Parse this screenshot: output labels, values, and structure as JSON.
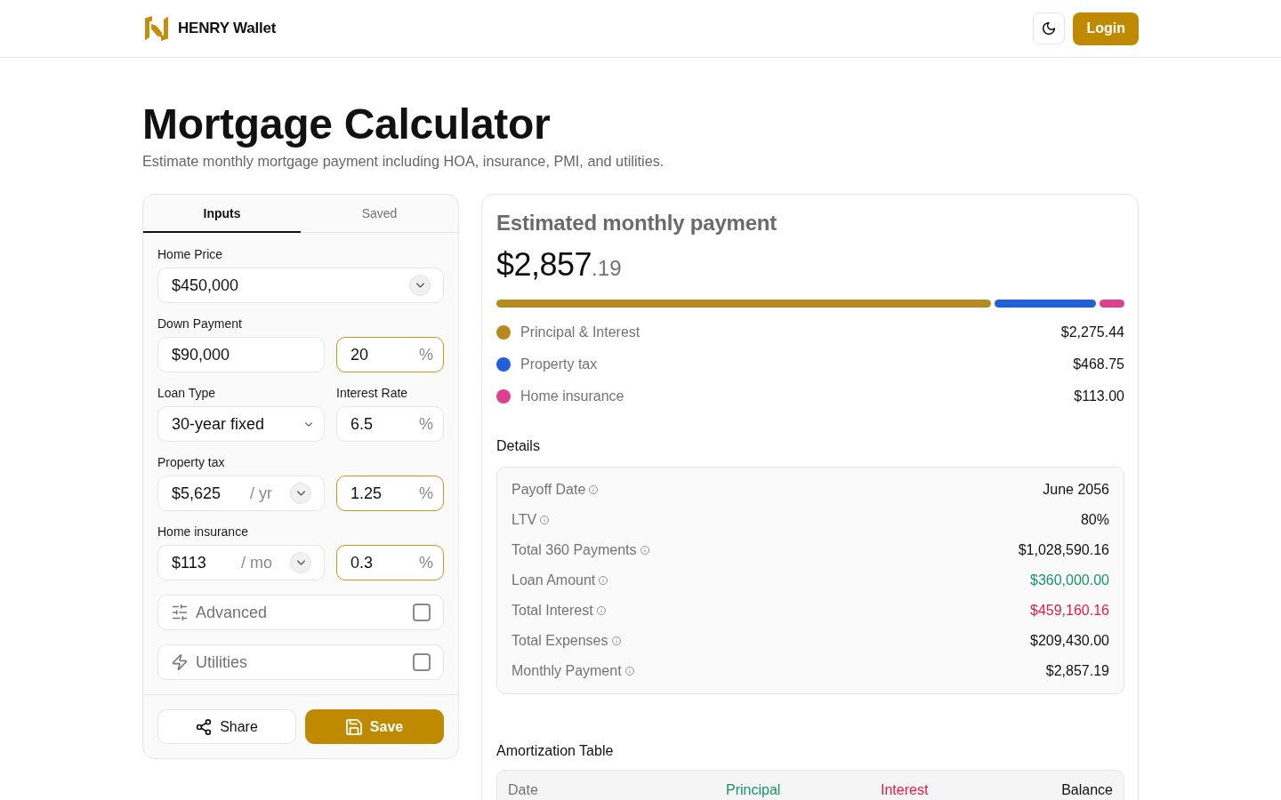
{
  "header": {
    "brand": "HENRY Wallet",
    "login_button": "Login"
  },
  "intro": {
    "title": "Mortgage Calculator",
    "subtitle": "Estimate monthly mortgage payment including HOA, insurance, PMI, and utilities."
  },
  "form": {
    "tabs": [
      {
        "label": "Inputs",
        "selected": true
      },
      {
        "label": "Saved",
        "selected": false
      }
    ],
    "rows": [
      {
        "label": "Home Price",
        "cells": [
          {
            "kind": "currency",
            "value": "$450,000",
            "dropdown": true
          }
        ]
      },
      {
        "label": "Down Payment",
        "cells": [
          {
            "kind": "currency",
            "value": "$90,000",
            "dropdown": false
          },
          {
            "kind": "percent",
            "value": "20",
            "suffix": "%",
            "accented": true
          }
        ]
      },
      {
        "cells": [
          {
            "label": "Loan Type",
            "kind": "select",
            "value": "30-year fixed"
          },
          {
            "label": "Interest Rate",
            "kind": "percent",
            "value": "6.5",
            "suffix": "%",
            "accented": false
          }
        ]
      },
      {
        "label": "Property tax",
        "cells": [
          {
            "kind": "currency",
            "value": "$5,625",
            "unit": "/ yr",
            "dropdown": true
          },
          {
            "kind": "percent",
            "value": "1.25",
            "suffix": "%",
            "accented": true
          }
        ]
      },
      {
        "label": "Home insurance",
        "cells": [
          {
            "kind": "currency",
            "value": "$113",
            "unit": "/ mo",
            "dropdown": true
          },
          {
            "kind": "percent",
            "value": "0.3",
            "suffix": "%",
            "accented": true
          }
        ]
      }
    ],
    "options": [
      {
        "label": "Advanced",
        "checked": false
      },
      {
        "label": "Utilities",
        "checked": false
      }
    ],
    "actions": [
      {
        "label": "Share",
        "kind": "secondary"
      },
      {
        "label": "Save",
        "kind": "primary"
      }
    ]
  },
  "summary": {
    "title": "Estimated monthly payment",
    "amount": "$2,857",
    "cents": ".19",
    "breakdown": [
      {
        "label": "Principal & Interest",
        "value": "$2,275.44",
        "color": "#b58a1f"
      },
      {
        "label": "Property tax",
        "value": "$468.75",
        "color": "#2160d9"
      },
      {
        "label": "Home insurance",
        "value": "$113.00",
        "color": "#dc4191"
      }
    ]
  },
  "details": {
    "heading": "Details",
    "rows": [
      {
        "label": "Payoff Date",
        "value": "June 2056",
        "color": "#111111"
      },
      {
        "label": "LTV",
        "value": "80%",
        "color": "#111111"
      },
      {
        "label": "Total 360 Payments",
        "value": "$1,028,590.16",
        "color": "#111111"
      },
      {
        "label": "Loan Amount",
        "value": "$360,000.00",
        "color": "#14956b"
      },
      {
        "label": "Total Interest",
        "value": "$459,160.16",
        "color": "#e11d48"
      },
      {
        "label": "Total Expenses",
        "value": "$209,430.00",
        "color": "#111111"
      },
      {
        "label": "Monthly Payment",
        "value": "$2,857.19",
        "color": "#111111"
      }
    ]
  },
  "amortization": {
    "heading": "Amortization Table",
    "columns": [
      {
        "label": "Date",
        "color": "#737373"
      },
      {
        "label": "Principal",
        "color": "#14956b"
      },
      {
        "label": "Interest",
        "color": "#e11d48"
      },
      {
        "label": "Balance",
        "color": "#111111"
      }
    ]
  }
}
